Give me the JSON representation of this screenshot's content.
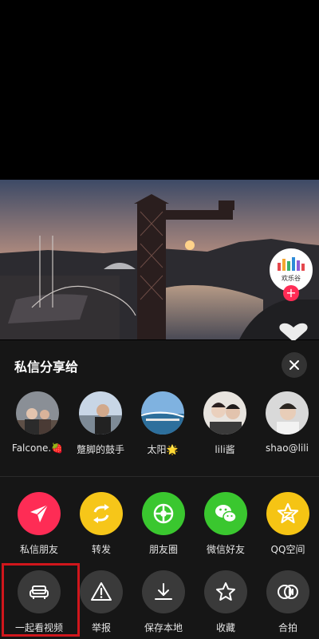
{
  "share_sheet": {
    "title": "私信分享给",
    "contacts": [
      {
        "name": "Falcone.🍓"
      },
      {
        "name": "蹩脚的鼓手"
      },
      {
        "name": "太阳🌟"
      },
      {
        "name": "lili酱"
      },
      {
        "name": "shao@lili"
      }
    ],
    "share_targets": [
      {
        "label": "私信朋友",
        "icon": "paper-plane-icon",
        "color": "#fe2c55"
      },
      {
        "label": "转发",
        "icon": "repost-arrows-icon",
        "color": "#f6c619"
      },
      {
        "label": "朋友圈",
        "icon": "wechat-moments-icon",
        "color": "#3ac72f"
      },
      {
        "label": "微信好友",
        "icon": "wechat-icon",
        "color": "#3ac72f"
      },
      {
        "label": "QQ空间",
        "icon": "qzone-star-icon",
        "color": "#f5c414"
      }
    ],
    "actions": [
      {
        "label": "一起看视频",
        "icon": "sofa-icon"
      },
      {
        "label": "举报",
        "icon": "warning-icon"
      },
      {
        "label": "保存本地",
        "icon": "download-icon"
      },
      {
        "label": "收藏",
        "icon": "star-outline-icon"
      },
      {
        "label": "合拍",
        "icon": "duet-icon"
      }
    ]
  },
  "creator": {
    "avatar_text": "欢乐谷",
    "follow_symbol": "+"
  }
}
